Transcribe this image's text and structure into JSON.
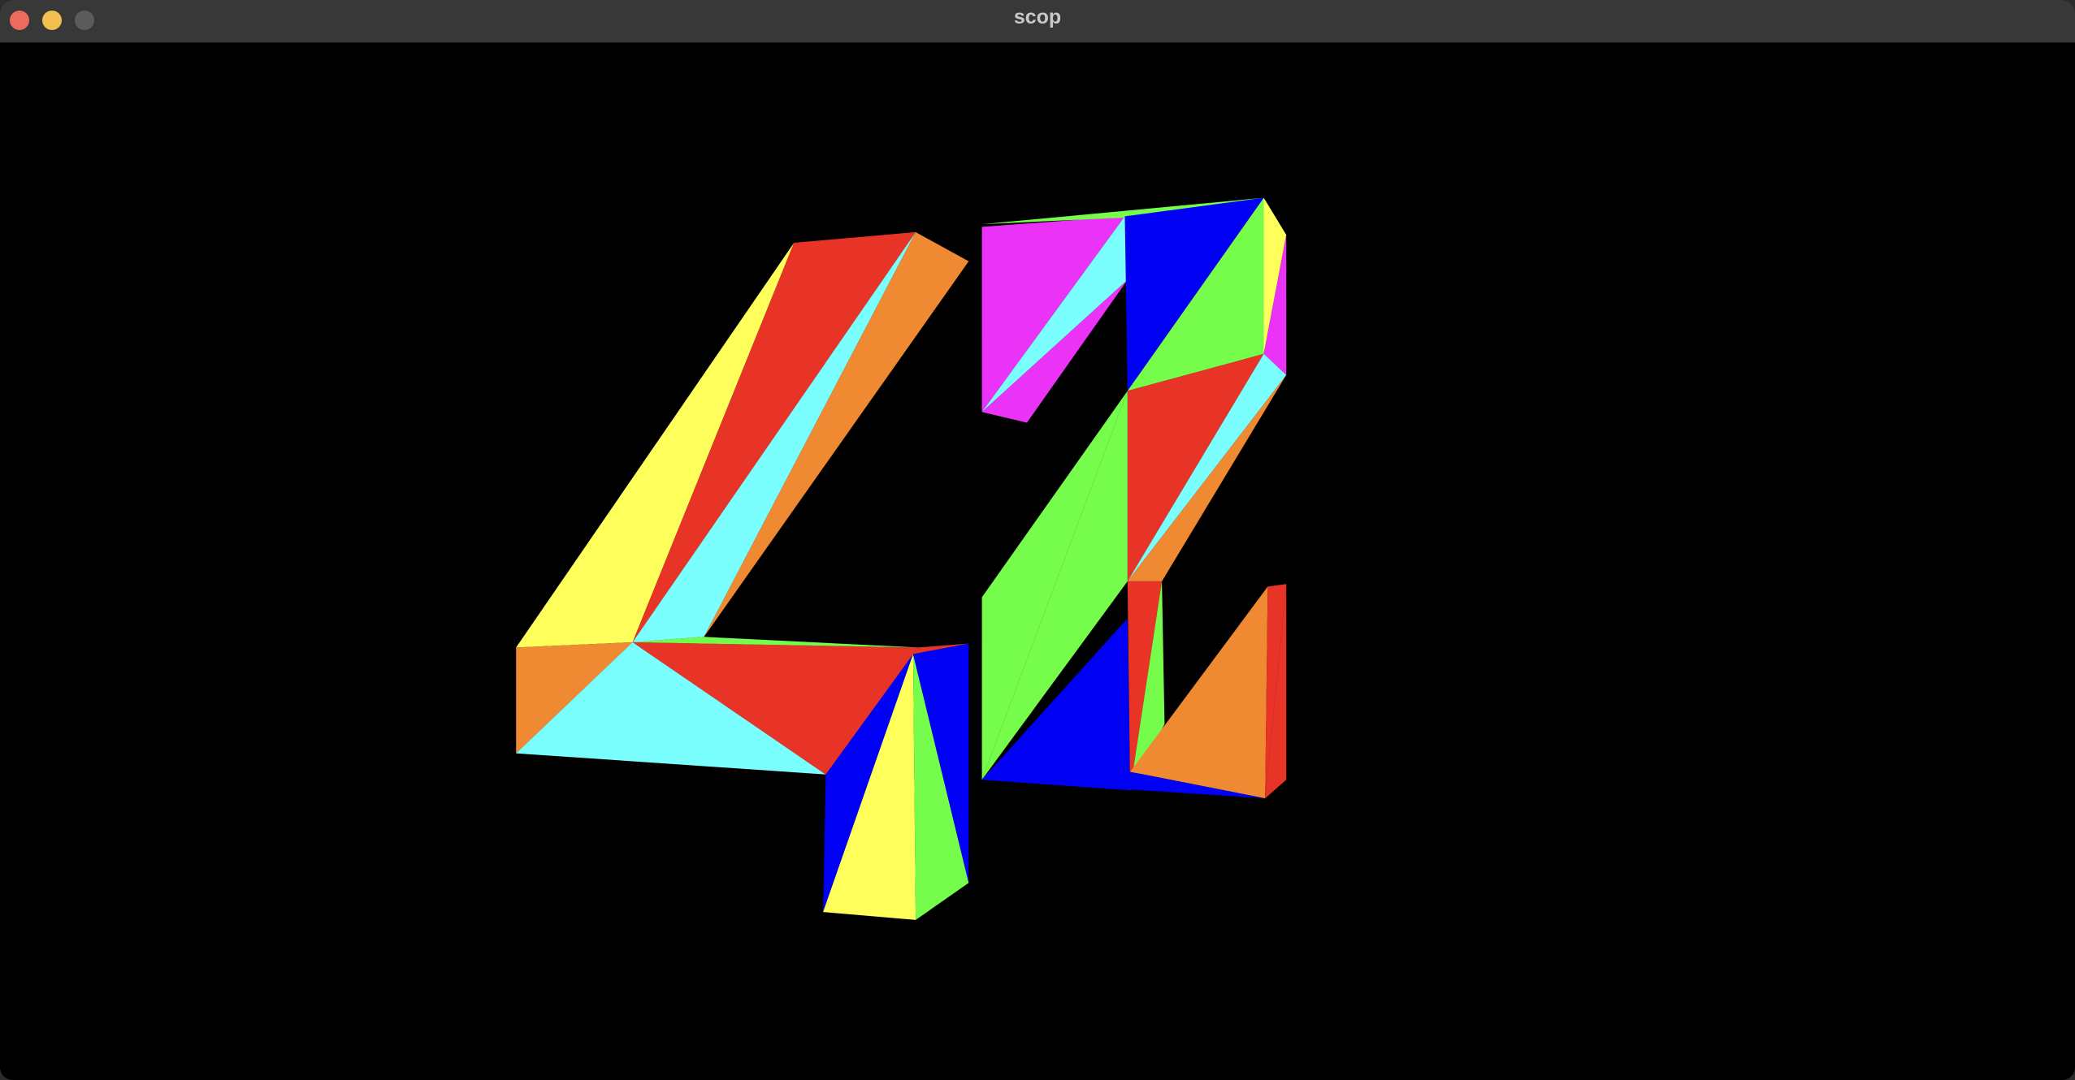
{
  "window": {
    "title": "scop"
  },
  "titlebar": {
    "close_icon": "close-icon",
    "minimize_icon": "minimize-icon",
    "zoom_icon": "zoom-icon"
  },
  "scene": {
    "background": "#000000",
    "model": "42",
    "palette": {
      "red": "#E83426",
      "yellow": "#FEFF5A",
      "cyan": "#7AFEFE",
      "orange": "#F08A32",
      "green": "#76FD4B",
      "blue": "#0000F4",
      "magenta": "#EA33F7"
    }
  }
}
